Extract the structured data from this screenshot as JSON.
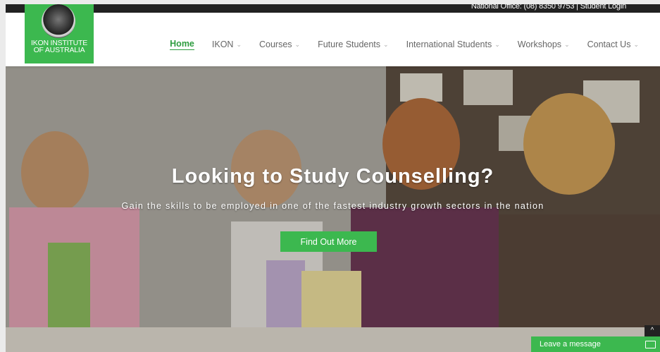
{
  "topbar": {
    "office_text": "National Office: (08) 8350 9753",
    "separator": " | ",
    "login_text": "Student Login"
  },
  "logo": {
    "line1": "IKON INSTITUTE",
    "line2": "OF AUSTRALIA"
  },
  "nav": {
    "items": [
      {
        "label": "Home"
      },
      {
        "label": "IKON"
      },
      {
        "label": "Courses"
      },
      {
        "label": "Future Students"
      },
      {
        "label": "International Students"
      },
      {
        "label": "Workshops"
      },
      {
        "label": "Contact Us"
      }
    ],
    "chevron": "⌄"
  },
  "hero": {
    "title": "Looking to Study Counselling?",
    "subtitle": "Gain the skills to be employed in one of the fastest industry growth sectors in the nation",
    "cta_label": "Find Out More"
  },
  "chat": {
    "label": "Leave a message"
  },
  "scroll_top": {
    "glyph": "^"
  },
  "colors": {
    "brand_green": "#3cb84f",
    "nav_active": "#2e9c3f",
    "topbar_bg": "#222222"
  }
}
